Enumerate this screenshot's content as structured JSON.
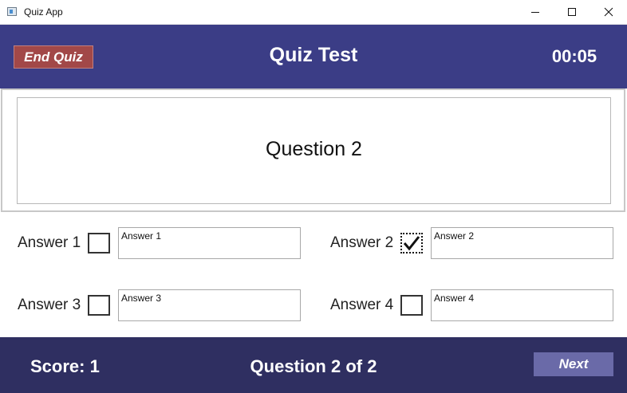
{
  "window": {
    "title": "Quiz App",
    "icons": [
      "app-icon",
      "minimize-icon",
      "maximize-icon",
      "close-icon"
    ]
  },
  "header": {
    "end_quiz_label": "End Quiz",
    "title": "Quiz Test",
    "timer": "00:05"
  },
  "question": {
    "text": "Question 2"
  },
  "answers": [
    {
      "label": "Answer 1",
      "value": "Answer 1",
      "checked": false
    },
    {
      "label": "Answer 2",
      "value": "Answer 2",
      "checked": true
    },
    {
      "label": "Answer 3",
      "value": "Answer 3",
      "checked": false
    },
    {
      "label": "Answer 4",
      "value": "Answer 4",
      "checked": false
    }
  ],
  "footer": {
    "score": "Score: 1",
    "progress": "Question 2 of 2",
    "next_label": "Next"
  },
  "colors": {
    "header_bg": "#3b3d86",
    "footer_bg": "#2f2f61",
    "end_quiz_bg": "#a24848",
    "next_bg": "#6a6aa8"
  }
}
